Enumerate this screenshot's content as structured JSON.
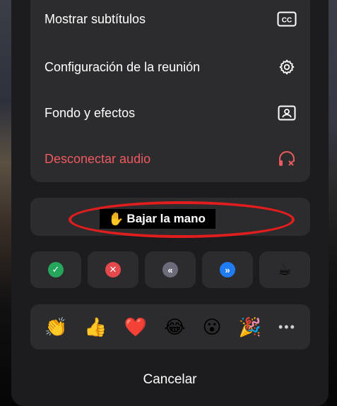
{
  "menu": {
    "items": [
      {
        "label": "Mostrar subtítulos",
        "icon": "closed-captions-icon"
      },
      {
        "label": "Configuración de la reunión",
        "icon": "gear-icon"
      },
      {
        "label": "Fondo y efectos",
        "icon": "background-portrait-icon"
      },
      {
        "label": "Desconectar audio",
        "icon": "headphones-disconnect-icon",
        "color": "#ee5a5f"
      }
    ],
    "cc_text": "CC"
  },
  "raise_hand": {
    "emoji": "✋",
    "label": "Bajar la mano"
  },
  "reactions": [
    {
      "name": "yes",
      "glyph": "✓",
      "color": "#26a55d"
    },
    {
      "name": "no",
      "glyph": "✕",
      "color": "#e5484d"
    },
    {
      "name": "slower",
      "glyph": "«",
      "color": "#6b6b7a"
    },
    {
      "name": "faster",
      "glyph": "»",
      "color": "#1f7cf5"
    },
    {
      "name": "coffee",
      "glyph": "☕",
      "color": ""
    }
  ],
  "emojis": [
    "👏",
    "👍",
    "❤️",
    "😂",
    "😮",
    "🎉"
  ],
  "more_label": "•••",
  "cancel_label": "Cancelar",
  "colors": {
    "danger": "#ee5a5f",
    "highlight_oval": "#e11d1d",
    "card": "#2c2c2e",
    "sheet": "#1c1c1e"
  }
}
